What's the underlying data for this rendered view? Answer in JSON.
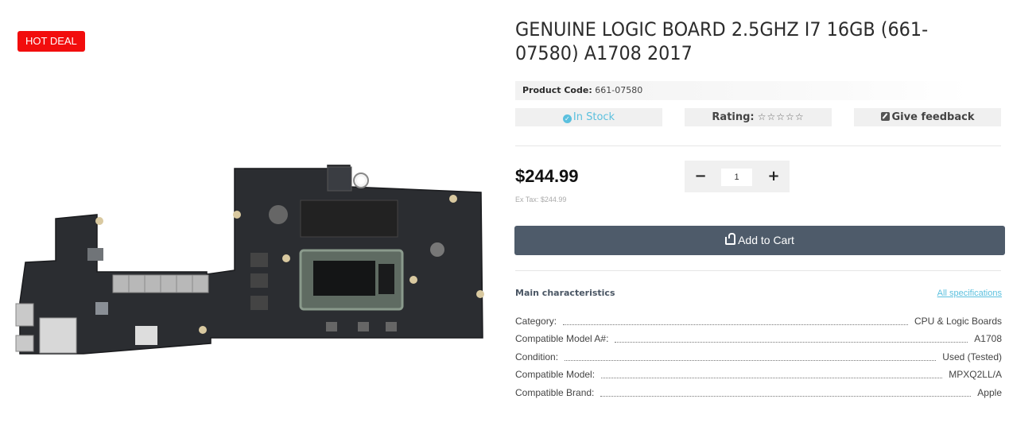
{
  "badge": {
    "label": "HOT DEAL",
    "color": "#f20d0d"
  },
  "product": {
    "title": "GENUINE LOGIC BOARD 2.5GHZ I7 16GB (661-07580) A1708 2017",
    "code_label": "Product Code:",
    "code_value": "661-07580",
    "stock": "In Stock",
    "rating_label": "Rating:",
    "rating_stars": "☆☆☆☆☆",
    "rating_value": 0,
    "feedback_label": "Give feedback",
    "price": "$244.99",
    "ex_tax": "Ex Tax: $244.99",
    "quantity": "1",
    "add_to_cart": "Add to Cart"
  },
  "characteristics": {
    "title": "Main characteristics",
    "all_specs_link": "All specifications",
    "items": [
      {
        "label": "Category:",
        "value": "CPU & Logic Boards"
      },
      {
        "label": "Compatible Model A#:",
        "value": "A1708"
      },
      {
        "label": "Condition:",
        "value": "Used (Tested)"
      },
      {
        "label": "Compatible Model:",
        "value": "MPXQ2LL/A"
      },
      {
        "label": "Compatible Brand:",
        "value": "Apple"
      }
    ]
  },
  "colors": {
    "accent": "#5bc0de",
    "cart_button": "#4e5b6a",
    "board": "#2b2d31"
  },
  "icons": {
    "stock": "check-circle-icon",
    "feedback": "pencil-square-icon",
    "cart": "basket-icon",
    "minus": "minus-icon",
    "plus": "plus-icon"
  }
}
